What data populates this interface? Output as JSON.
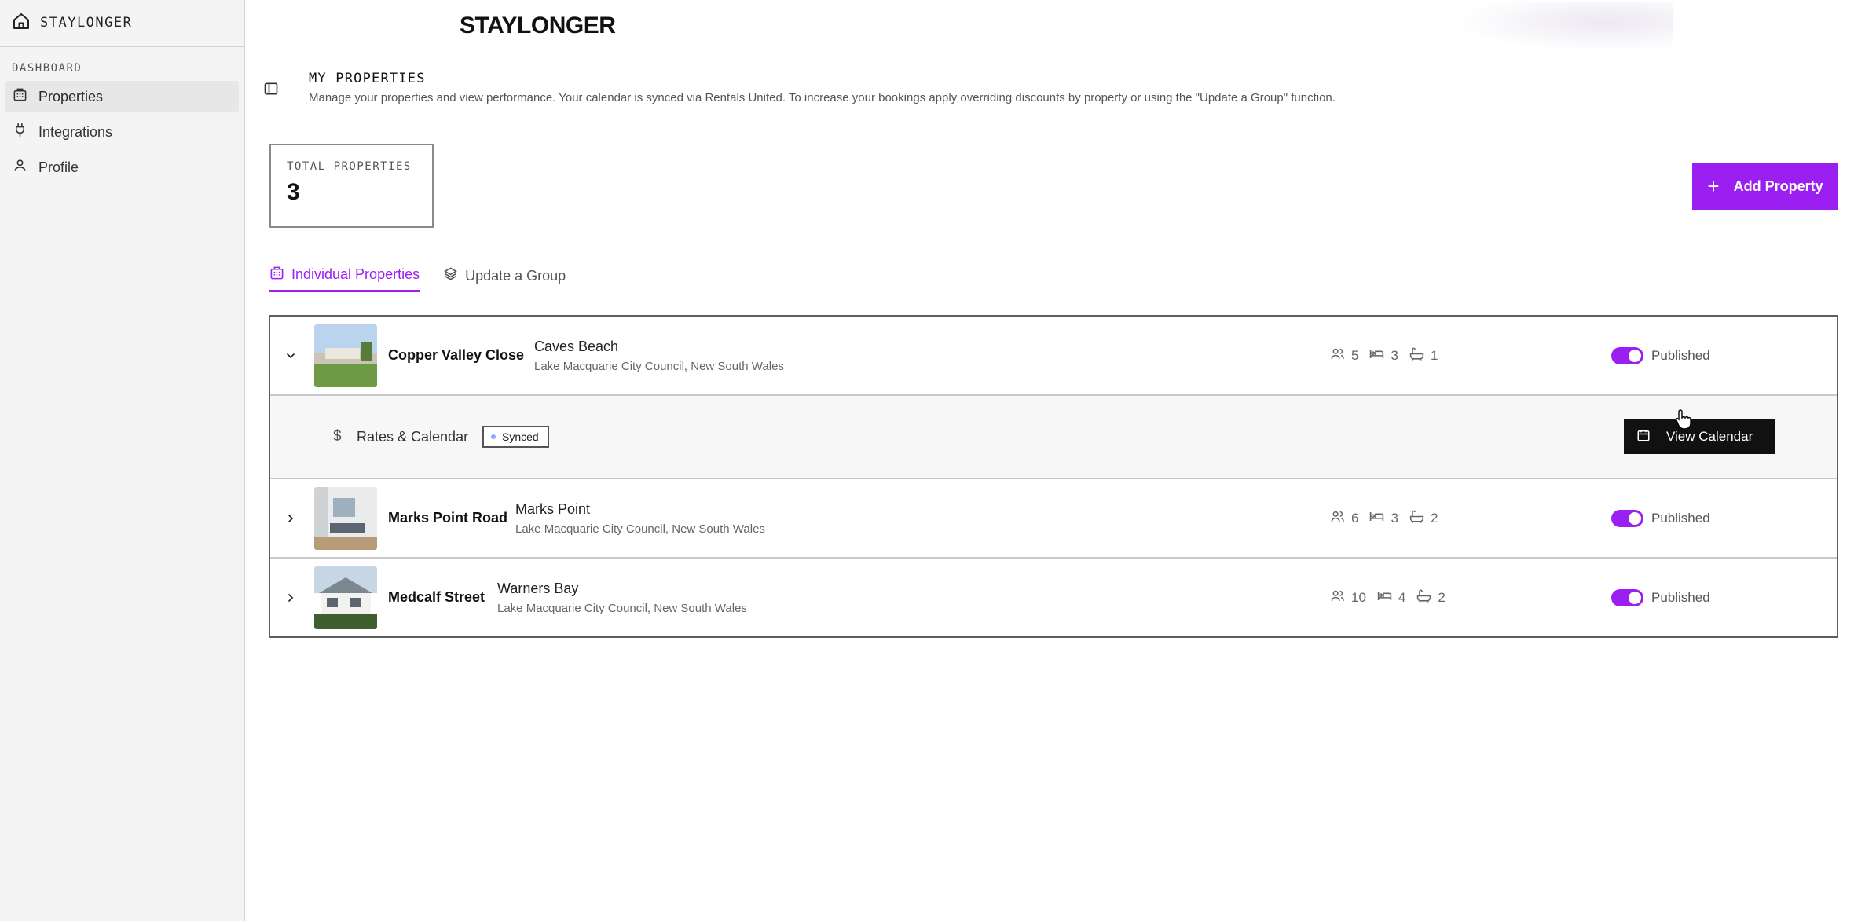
{
  "brand": "STAYLONGER",
  "sidebar": {
    "heading": "DASHBOARD",
    "items": [
      {
        "label": "Properties",
        "icon": "building-icon",
        "active": true
      },
      {
        "label": "Integrations",
        "icon": "plug-icon",
        "active": false
      },
      {
        "label": "Profile",
        "icon": "user-icon",
        "active": false
      }
    ]
  },
  "header": {
    "logo": "STAYLONGER",
    "title": "MY PROPERTIES",
    "description": "Manage your properties and view performance. Your calendar is synced via Rentals United. To increase your bookings apply overriding discounts by property or using the \"Update a Group\" function."
  },
  "stats": {
    "label": "TOTAL PROPERTIES",
    "value": "3"
  },
  "actions": {
    "add_property": "Add Property",
    "add_icon": "+"
  },
  "tabs": [
    {
      "label": "Individual Properties",
      "active": true
    },
    {
      "label": "Update a Group",
      "active": false
    }
  ],
  "properties": [
    {
      "name": "Copper Valley Close",
      "city": "Caves Beach",
      "region": "Lake Macquarie City Council, New South Wales",
      "guests": "5",
      "beds": "3",
      "baths": "1",
      "status": "Published",
      "published": true,
      "expanded": true
    },
    {
      "name": "Marks Point Road",
      "city": "Marks Point",
      "region": "Lake Macquarie City Council, New South Wales",
      "guests": "6",
      "beds": "3",
      "baths": "2",
      "status": "Published",
      "published": true,
      "expanded": false
    },
    {
      "name": "Medcalf Street",
      "city": "Warners Bay",
      "region": "Lake Macquarie City Council, New South Wales",
      "guests": "10",
      "beds": "4",
      "baths": "2",
      "status": "Published",
      "published": true,
      "expanded": false
    }
  ],
  "expanded_panel": {
    "icon": "$",
    "label": "Rates & Calendar",
    "badge": "Synced",
    "button": "View Calendar"
  },
  "colors": {
    "accent": "#9b1ff0",
    "dark_button": "#111111",
    "sync_dot": "#8fa8ff"
  }
}
